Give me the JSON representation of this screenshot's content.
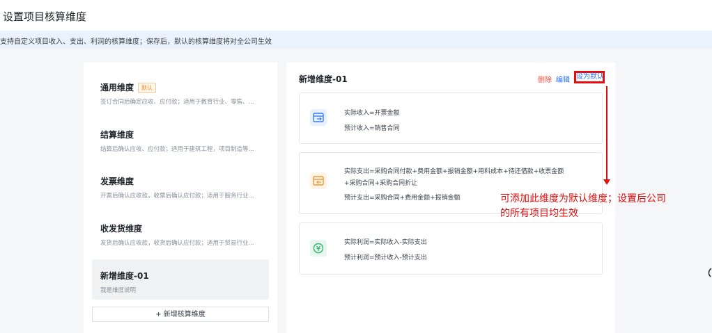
{
  "page": {
    "title": "设置项目核算维度",
    "notice": "支持自定义项目收入、支出、利润的核算维度；保存后，默认的核算维度将对全公司生效"
  },
  "dimensions": [
    {
      "name": "通用维度",
      "badge": "默认",
      "desc": "签订合同后确定应收、应付款；适用于教育行业、零售、..."
    },
    {
      "name": "结算维度",
      "desc": "结算后确认应收、应付款；适用于建筑工程，项目制造等..."
    },
    {
      "name": "发票维度",
      "desc": "开票后确认应收款，收票后确认应付款；适用于服务行业..."
    },
    {
      "name": "收发货维度",
      "desc": "发货后确认应收款，收货后确认应付款；适用于贸易行业..."
    },
    {
      "name": "新增维度-01",
      "desc": "我是维度说明"
    }
  ],
  "add_button": "+ 新增核算维度",
  "detail": {
    "title": "新增维度-01",
    "actions": {
      "delete": "删除",
      "edit": "编辑",
      "set_default": "设为默认"
    },
    "income": {
      "line1": "实际收入=开票金额",
      "line2": "预计收入=销售合同"
    },
    "expense": {
      "line1": "实际支出=采购合同付款+费用金额+报销金额+用料成本+待还借款+收票金额",
      "line2": "+采购合同+采购合同折让",
      "line3": "预计支出=采购合同+费用金额+报销金额"
    },
    "profit": {
      "line1": "实际利润=实际收入-实际支出",
      "line2": "预计利润=预计收入-预计支出"
    }
  },
  "annotation": {
    "line1": "可添加此维度为默认维度；设置后公司",
    "line2": "的所有项目均生效"
  },
  "colors": {
    "accent": "#2b6cf5",
    "danger": "#f5503d",
    "annotation": "#e30d0d",
    "badge": "#f08a24"
  }
}
